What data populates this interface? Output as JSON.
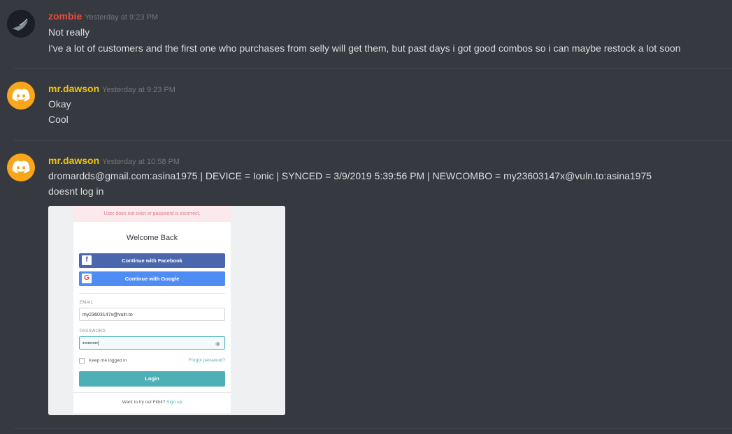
{
  "messages": [
    {
      "username": "zombie",
      "username_color": "#e74c3c",
      "timestamp": "Yesterday at 9:23 PM",
      "lines": [
        "Not really",
        "I've a lot of customers and the first one who purchases from selly will get them, but past days i got good combos so i can maybe restock a lot soon"
      ]
    },
    {
      "username": "mr.dawson",
      "username_color": "#f1c40f",
      "timestamp": "Yesterday at 9:23 PM",
      "lines": [
        "Okay",
        "Cool"
      ]
    },
    {
      "username": "mr.dawson",
      "username_color": "#f1c40f",
      "timestamp": "Yesterday at 10:58 PM",
      "lines": [
        "dromardds@gmail.com:asina1975 | DEVICE = Ionic | SYNCED = 3/9/2019 5:39:56 PM | NEWCOMBO = my23603147x@vuln.to:asina1975",
        "doesnt log in"
      ]
    }
  ],
  "attachment": {
    "error_text": "User does not exist or password is incorrect.",
    "heading": "Welcome Back",
    "facebook_button": "Continue with Facebook",
    "google_button": "Continue with Google",
    "email_label": "EMAIL",
    "email_value": "my23603147x@vuln.to",
    "password_label": "PASSWORD",
    "password_value": "•••••••••|",
    "keep_logged_in": "Keep me logged in",
    "forgot_password": "Forgot password?",
    "login_button": "Login",
    "try_text": "Want to try out Fitbit?",
    "signup_link": "Sign up"
  },
  "colors": {
    "background": "#36393f",
    "discord_avatar": "#faa61a",
    "text": "#dcddde",
    "timestamp": "#72767d"
  }
}
